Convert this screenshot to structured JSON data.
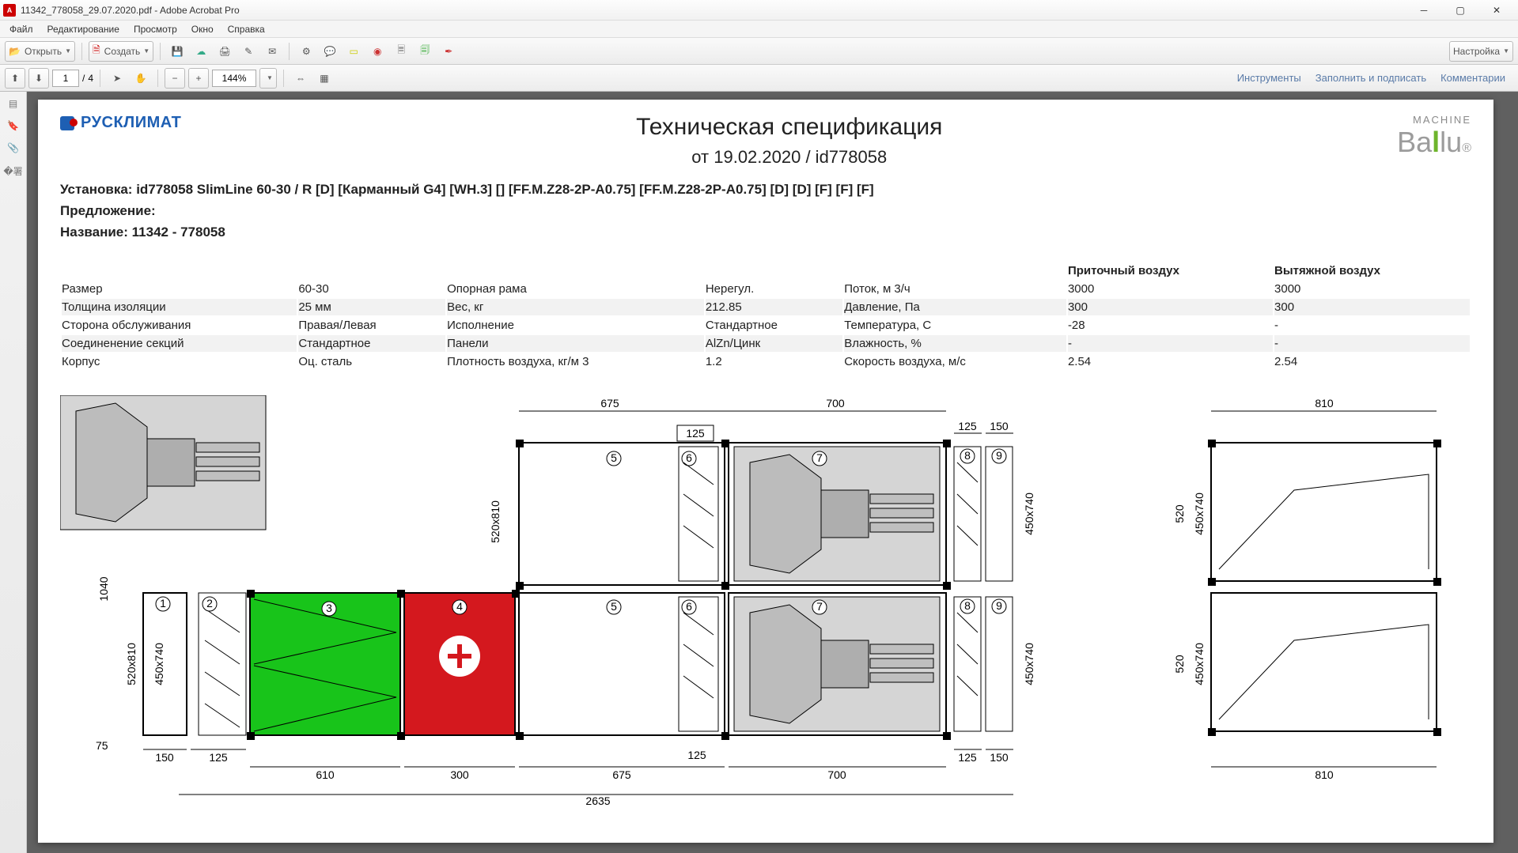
{
  "app": {
    "title": "11342_778058_29.07.2020.pdf - Adobe Acrobat Pro"
  },
  "menu": {
    "file": "Файл",
    "edit": "Редактирование",
    "view": "Просмотр",
    "window": "Окно",
    "help": "Справка"
  },
  "toolbar": {
    "open": "Открыть",
    "create": "Создать",
    "settings": "Настройка"
  },
  "nav": {
    "page_current": "1",
    "page_sep": "/",
    "page_total": "4",
    "zoom": "144%"
  },
  "panels": {
    "tools": "Инструменты",
    "fillsign": "Заполнить и подписать",
    "comments": "Комментарии"
  },
  "doc": {
    "logo_text": "РУСКЛИМАТ",
    "ballu_machine": "MACHINE",
    "ballu": "Ballu",
    "title": "Техническая спецификация",
    "subtitle": "от 19.02.2020 / id778058",
    "line_install_label": "Установка:",
    "line_install_val": "id778058 SlimLine 60-30 / R [D] [Карманный G4] [WH.3] [] [FF.M.Z28-2P-A0.75] [FF.M.Z28-2P-A0.75] [D] [D] [F] [F] [F]",
    "line_offer": "Предложение:",
    "line_name_label": "Название:",
    "line_name_val": "11342 - 778058",
    "cols": {
      "supply": "Приточный воздух",
      "exhaust": "Вытяжной воздух"
    },
    "rows": [
      {
        "a": "Размер",
        "av": "60-30",
        "b": "Опорная рама",
        "bv": "Нерегул.",
        "c": "Поток, м 3/ч",
        "cv1": "3000",
        "cv2": "3000"
      },
      {
        "a": "Толщина изоляции",
        "av": "25 мм",
        "b": "Вес, кг",
        "bv": "212.85",
        "c": "Давление, Па",
        "cv1": "300",
        "cv2": "300"
      },
      {
        "a": "Сторона обслуживания",
        "av": "Правая/Левая",
        "b": "Исполнение",
        "bv": "Стандартное",
        "c": "Температура, С",
        "cv1": "-28",
        "cv2": "-"
      },
      {
        "a": "Соединенение секций",
        "av": "Стандартное",
        "b": "Панели",
        "bv": "AlZn/Цинк",
        "c": "Влажность, %",
        "cv1": "-",
        "cv2": "-"
      },
      {
        "a": "Корпус",
        "av": "Оц. сталь",
        "b": "Плотность воздуха, кг/м 3",
        "bv": "1.2",
        "c": "Скорость воздуха, м/с",
        "cv1": "2.54",
        "cv2": "2.54"
      }
    ],
    "dims": {
      "d675": "675",
      "d700": "700",
      "d810": "810",
      "d125": "125",
      "d150": "150",
      "d520x810": "520x810",
      "d450x740": "450x740",
      "d1040": "1040",
      "d520": "520",
      "d610": "610",
      "d300": "300",
      "d2635": "2635",
      "d75": "75"
    }
  }
}
